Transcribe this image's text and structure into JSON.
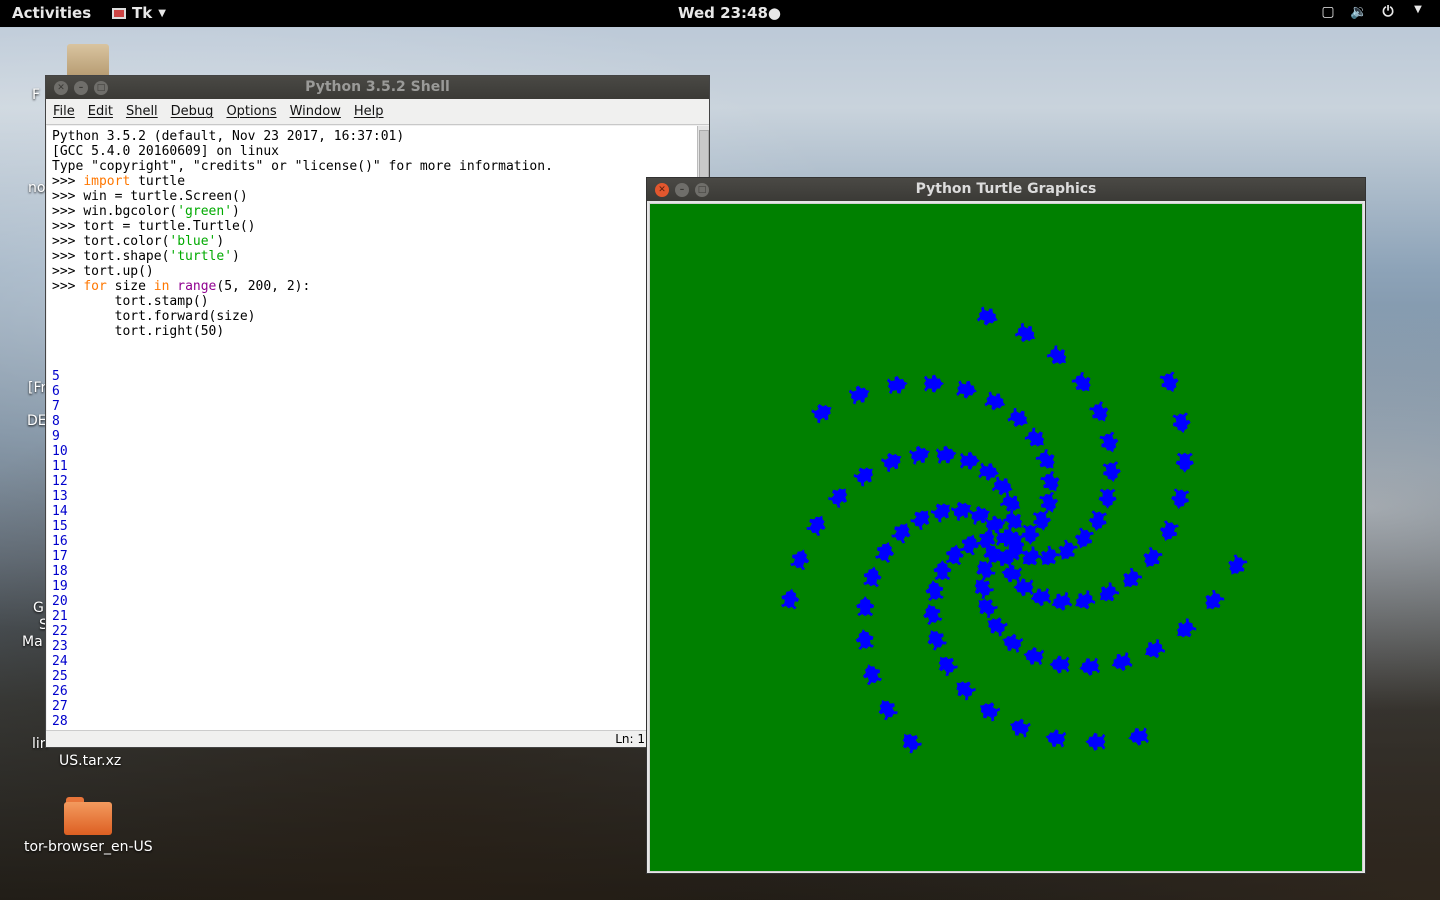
{
  "topbar": {
    "activities": "Activities",
    "app_name": "Tk",
    "clock": "Wed 23:48",
    "clock_dot": "●"
  },
  "desktop": {
    "icons": [
      {
        "label_top": "F",
        "label_partial": "no"
      },
      {
        "label": "[Fr"
      },
      {
        "label": "DE"
      },
      {
        "label": "G"
      },
      {
        "label": "S"
      },
      {
        "label": "Ma"
      },
      {
        "label": "lin"
      },
      {
        "label": "US.tar.xz"
      },
      {
        "label": "tor-browser_en-US"
      }
    ]
  },
  "idle_window": {
    "title": "Python 3.5.2 Shell",
    "menu": [
      "File",
      "Edit",
      "Shell",
      "Debug",
      "Options",
      "Window",
      "Help"
    ],
    "banner": [
      "Python 3.5.2 (default, Nov 23 2017, 16:37:01)",
      "[GCC 5.4.0 20160609] on linux",
      "Type \"copyright\", \"credits\" or \"license()\" for more information."
    ],
    "prompt": ">>> ",
    "code": [
      {
        "kw": "import",
        "rest": " turtle"
      },
      {
        "plain": "win = turtle.Screen()"
      },
      {
        "plain": "win.bgcolor(",
        "str": "'green'",
        "end": ")"
      },
      {
        "plain": "tort = turtle.Turtle()"
      },
      {
        "plain": "tort.color(",
        "str": "'blue'",
        "end": ")"
      },
      {
        "plain": "tort.shape(",
        "str": "'turtle'",
        "end": ")"
      },
      {
        "plain": "tort.up()"
      }
    ],
    "for_line": {
      "kw1": "for",
      "mid": " size ",
      "kw2": "in",
      "bi": "range",
      "rest": "(5, 200, 2):"
    },
    "body_lines": [
      "tort.stamp()",
      "tort.forward(size)",
      "tort.right(50)"
    ],
    "output": [
      "5",
      "6",
      "7",
      "8",
      "9",
      "10",
      "11",
      "12",
      "13",
      "14",
      "15",
      "16",
      "17",
      "18",
      "19",
      "20",
      "21",
      "22",
      "23",
      "24",
      "25",
      "26",
      "27",
      "28"
    ],
    "status": "Ln: 1"
  },
  "turtle_window": {
    "title": "Python Turtle Graphics",
    "bgcolor": "#008000",
    "pen_color": "#0000ff",
    "spiral": {
      "start": 5,
      "stop": 200,
      "step": 2,
      "turn_deg": 50
    }
  }
}
